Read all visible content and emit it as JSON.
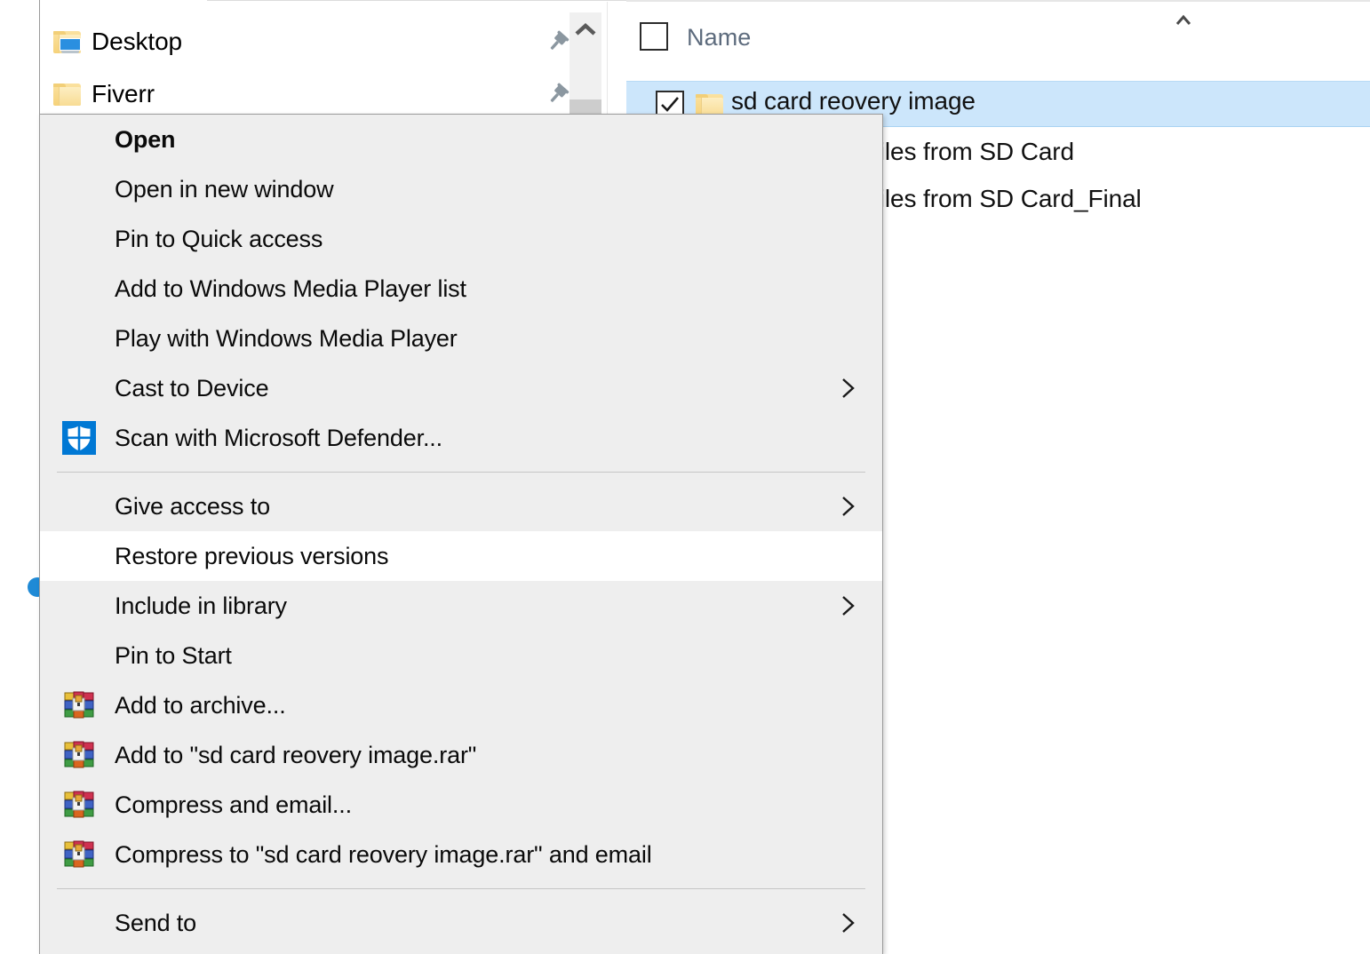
{
  "nav_pane": {
    "items": [
      {
        "label": "Desktop",
        "icon": "desktop-folder-icon",
        "pinned": true
      },
      {
        "label": "Fiverr",
        "icon": "folder-icon",
        "pinned": true
      }
    ],
    "scrollbar": {
      "up_arrow_icon": "chevron-up-icon"
    }
  },
  "file_list": {
    "column_header": {
      "label": "Name",
      "select_all_checkbox": "unchecked",
      "sort_indicator": "ascending"
    },
    "rows": [
      {
        "label": "sd card reovery image",
        "checked": true,
        "selected": true,
        "icon": "folder-icon"
      },
      {
        "label": "ver Deleted Files from SD Card",
        "checked": false,
        "selected": false,
        "icon": "folder-icon"
      },
      {
        "label": "ver Deleted Files from SD Card_Final",
        "checked": false,
        "selected": false,
        "icon": "folder-icon"
      }
    ]
  },
  "context_menu": {
    "items": [
      {
        "label": "Open",
        "bold": true,
        "icon": null,
        "submenu": false,
        "hovered": false
      },
      {
        "label": "Open in new window",
        "bold": false,
        "icon": null,
        "submenu": false,
        "hovered": false
      },
      {
        "label": "Pin to Quick access",
        "bold": false,
        "icon": null,
        "submenu": false,
        "hovered": false
      },
      {
        "label": "Add to Windows Media Player list",
        "bold": false,
        "icon": null,
        "submenu": false,
        "hovered": false
      },
      {
        "label": "Play with Windows Media Player",
        "bold": false,
        "icon": null,
        "submenu": false,
        "hovered": false
      },
      {
        "label": "Cast to Device",
        "bold": false,
        "icon": null,
        "submenu": true,
        "hovered": false
      },
      {
        "label": "Scan with Microsoft Defender...",
        "bold": false,
        "icon": "microsoft-defender-shield-icon",
        "submenu": false,
        "hovered": false
      },
      {
        "separator": true
      },
      {
        "label": "Give access to",
        "bold": false,
        "icon": null,
        "submenu": true,
        "hovered": false
      },
      {
        "label": "Restore previous versions",
        "bold": false,
        "icon": null,
        "submenu": false,
        "hovered": true
      },
      {
        "label": "Include in library",
        "bold": false,
        "icon": null,
        "submenu": true,
        "hovered": false
      },
      {
        "label": "Pin to Start",
        "bold": false,
        "icon": null,
        "submenu": false,
        "hovered": false
      },
      {
        "label": "Add to archive...",
        "bold": false,
        "icon": "winrar-icon",
        "submenu": false,
        "hovered": false
      },
      {
        "label": "Add to \"sd card reovery image.rar\"",
        "bold": false,
        "icon": "winrar-icon",
        "submenu": false,
        "hovered": false
      },
      {
        "label": "Compress and email...",
        "bold": false,
        "icon": "winrar-icon",
        "submenu": false,
        "hovered": false
      },
      {
        "label": "Compress to \"sd card reovery image.rar\" and email",
        "bold": false,
        "icon": "winrar-icon",
        "submenu": false,
        "hovered": false
      },
      {
        "separator": true
      },
      {
        "label": "Send to",
        "bold": false,
        "icon": null,
        "submenu": true,
        "hovered": false
      }
    ]
  },
  "colors": {
    "menu_background": "#eeeeee",
    "menu_hover": "#ffffff",
    "selection_blue": "#cce6fb",
    "defender_blue": "#0078d4",
    "header_text": "#5d6b7d",
    "folder_yellow": "#f6d27a"
  }
}
